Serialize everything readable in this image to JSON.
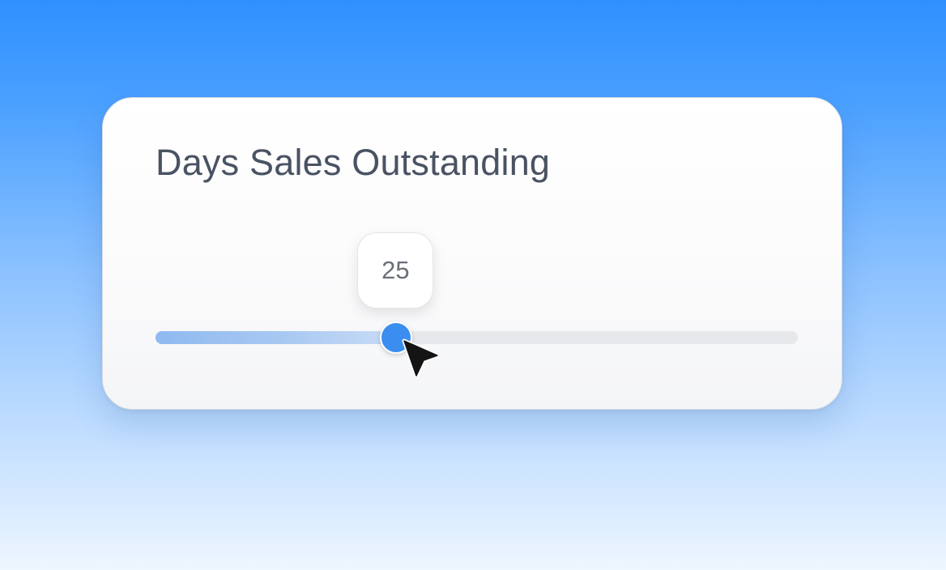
{
  "card": {
    "title": "Days Sales Outstanding"
  },
  "slider": {
    "value": "25",
    "fraction": 0.375,
    "fill_color": "#8fbaf0",
    "thumb_color": "#3b8df0",
    "track_color": "#e6e8eb"
  },
  "cursor": {
    "icon": "arrow-pointer-icon"
  }
}
